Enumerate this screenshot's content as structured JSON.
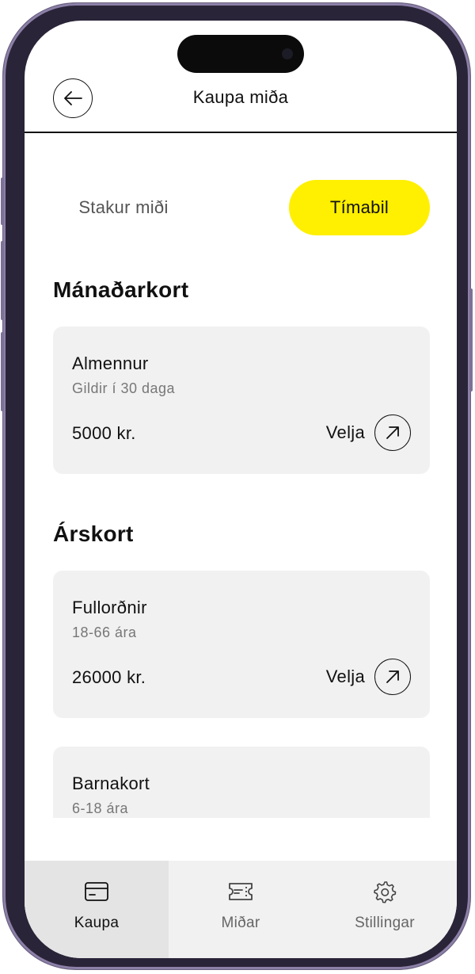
{
  "header": {
    "title": "Kaupa miða"
  },
  "tabs": [
    {
      "label": "Stakur miði",
      "active": false
    },
    {
      "label": "Tímabil",
      "active": true
    }
  ],
  "sections": [
    {
      "title": "Mánaðarkort",
      "cards": [
        {
          "name": "Almennur",
          "subtitle": "Gildir í 30 daga",
          "price": "5000 kr.",
          "select_label": "Velja"
        }
      ]
    },
    {
      "title": "Árskort",
      "cards": [
        {
          "name": "Fullorðnir",
          "subtitle": "18-66 ára",
          "price": "26000 kr.",
          "select_label": "Velja"
        },
        {
          "name": "Barnakort",
          "subtitle": "6-18 ára"
        }
      ]
    }
  ],
  "bottom_nav": [
    {
      "label": "Kaupa",
      "icon": "credit-card-icon",
      "active": true
    },
    {
      "label": "Miðar",
      "icon": "ticket-icon",
      "active": false
    },
    {
      "label": "Stillingar",
      "icon": "gear-icon",
      "active": false
    }
  ],
  "colors": {
    "accent": "#ffef00",
    "card": "#f1f1f1",
    "nav": "#f1f1f1",
    "frame": "#2a2438"
  }
}
